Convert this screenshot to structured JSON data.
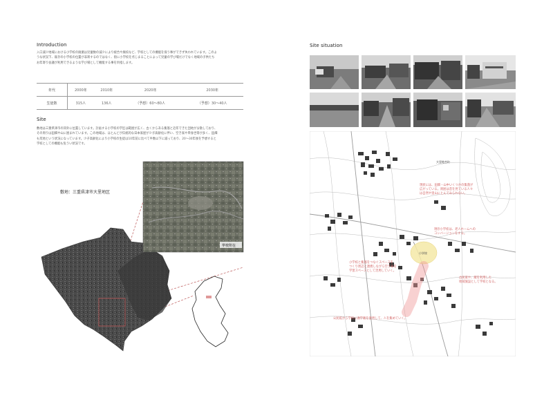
{
  "left": {
    "intro_title": "Introduction",
    "intro_lines": [
      "入口減少地域における小学校の廃業は児童数の減少により統合や廃校など、学校としての機能を保う事ができず失われています。このよ",
      "うな状況下、既存の小学校の位置が非寄するのではなく、街に小学校を点じまることによって児童の学び場だけでなく地域の子供たち",
      "お年寄り会議が利用できるような学び場として機能する事を目指します。"
    ],
    "table": {
      "headers": [
        "年代",
        "2000年",
        "2010年",
        "2020年",
        "2030年"
      ],
      "row_label": "生徒数",
      "values": [
        "315人",
        "136人",
        "（予想）60〜80人",
        "（予想）30〜40人"
      ]
    },
    "site_title": "Site",
    "site_lines": [
      "敷地は三重県津市の郊外に位置しています。計画する小学校の学区は範囲が広く、古くからある集落と近年できた団地が分散しており、",
      "その周りは田畑や山に囲まれています。この地域は、ほとんどが伝統的な日本家屋が少子高齢化に伴い、空き家や単身世帯が多く、田畑",
      "も荒地という状況になっています。少子高齢化により小学校の生徒は10年前に比べて半数以下に減っており、20〜30年後を予想すると",
      "学校としての機能も危うい状況です。"
    ],
    "map_caption": "敷地：三重県津市大里地区",
    "aerial_label": "学校所在"
  },
  "right": {
    "site_situation_title": "Site situation",
    "map_tags": [
      "大里睦合町",
      "小学校"
    ],
    "notes": [
      "現状には、田畑・山中いくつかの集落が\n広がっている。周囲は昔を見ている人々\nは自然や里山にとんでみられない。",
      "現存小学校は、老人ホームへの\nコンバージョンをする。",
      "小学校と集落をつなぐスペースを\nつくり周辺と連携しながら空き家を\n学習スペースとして活用していく。",
      "古民家や、蔵を利用した\n地域施設として学校となる。",
      "公民館から学校に通学路を使用して、人を集めていく。"
    ]
  },
  "colors": {
    "accent": "#d46a6a",
    "highlight": "#f5e9a8"
  }
}
